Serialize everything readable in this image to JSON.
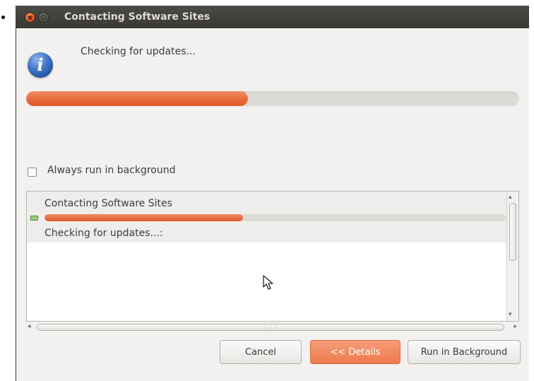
{
  "window": {
    "title": "Contacting Software Sites",
    "status_message": "Checking for updates...",
    "progress_fraction": 0.45,
    "accent_color": "#e9693a",
    "icon": "info-icon"
  },
  "options": {
    "always_background_label": "Always run in background",
    "always_background_checked": false
  },
  "details": {
    "jobs": [
      {
        "title": "Contacting Software Sites",
        "progress_fraction": 0.43,
        "subtask": "Checking for updates...:"
      }
    ]
  },
  "buttons": {
    "cancel": "Cancel",
    "details": "<< Details",
    "background": "Run in Background"
  }
}
